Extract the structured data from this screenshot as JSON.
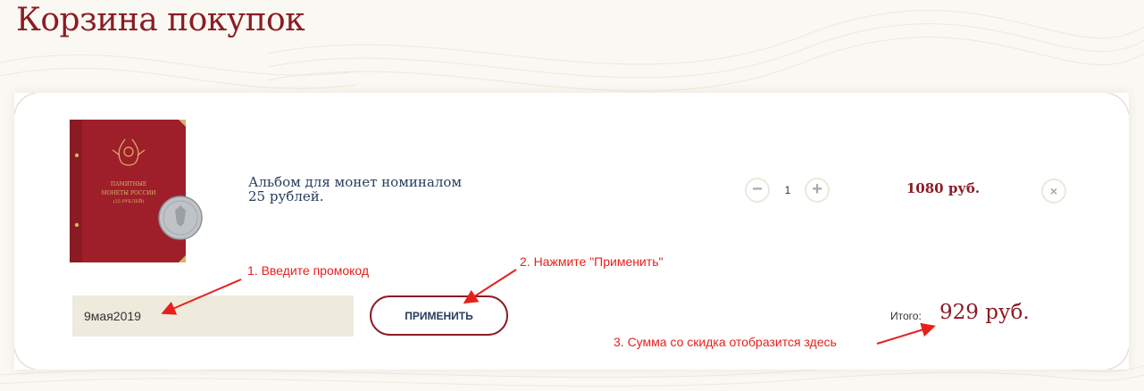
{
  "page": {
    "title": "Корзина покупок"
  },
  "cart": {
    "item": {
      "name": "Альбом для монет номиналом 25 рублей.",
      "quantity": "1",
      "price": "1080 руб.",
      "decrease_icon": "−",
      "increase_icon": "+",
      "remove_icon": "×",
      "image_text": "ПАМЯТНЫЕ МОНЕТЫ РОССИИ (25 РУБЛЕЙ)"
    },
    "promo": {
      "value": "9мая2019",
      "apply_label": "ПРИМЕНИТЬ"
    },
    "total": {
      "label": "Итого:",
      "value": "929 руб."
    }
  },
  "annotations": {
    "step1": "1. Введите промокод",
    "step2": "2. Нажмите \"Применить\"",
    "step3": "3. Сумма со скидка отобразится здесь"
  },
  "colors": {
    "accent": "#8b1c24",
    "annotation": "#e8201b",
    "input_bg": "#eeebdd",
    "text_dark": "#263d5c"
  }
}
